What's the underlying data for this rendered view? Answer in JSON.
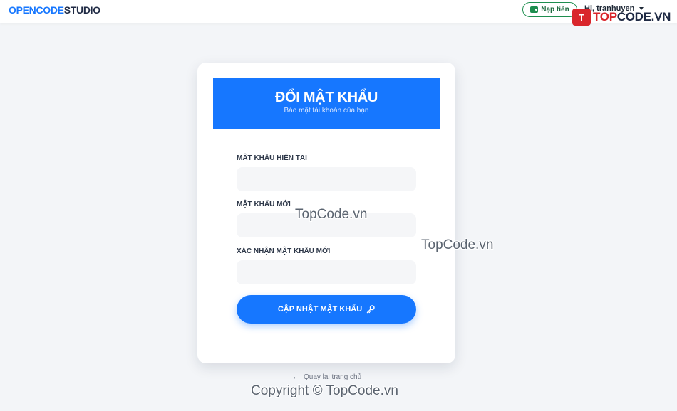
{
  "header": {
    "logo_part1": "OPENCODE",
    "logo_part2": "STUDIO",
    "topup_label": "Nạp tiền",
    "user_greeting": "Hi, tranhuyen",
    "watermark_badge": "T",
    "watermark_brand_1": "TOP",
    "watermark_brand_2": "CODE.VN"
  },
  "card": {
    "title": "ĐỔI MẬT KHẨU",
    "subtitle": "Bảo mật tài khoản của bạn",
    "fields": [
      {
        "label": "MẬT KHẨU HIỆN TẠI",
        "value": "",
        "placeholder": ""
      },
      {
        "label": "MẬT KHẨU MỚI",
        "value": "",
        "placeholder": ""
      },
      {
        "label": "XÁC NHẬN MẬT KHẨU MỚI",
        "value": "",
        "placeholder": ""
      }
    ],
    "submit_label": "CẬP NHẬT MẬT KHẨU"
  },
  "back_link": {
    "label": "Quay lại trang chủ"
  },
  "watermarks": {
    "center": "TopCode.vn",
    "right": "TopCode.vn",
    "copyright": "Copyright © TopCode.vn"
  },
  "colors": {
    "primary": "#1677ff",
    "topup_green": "#1e8e4f",
    "watermark_red": "#d9262c",
    "background": "#f3f5f8"
  }
}
